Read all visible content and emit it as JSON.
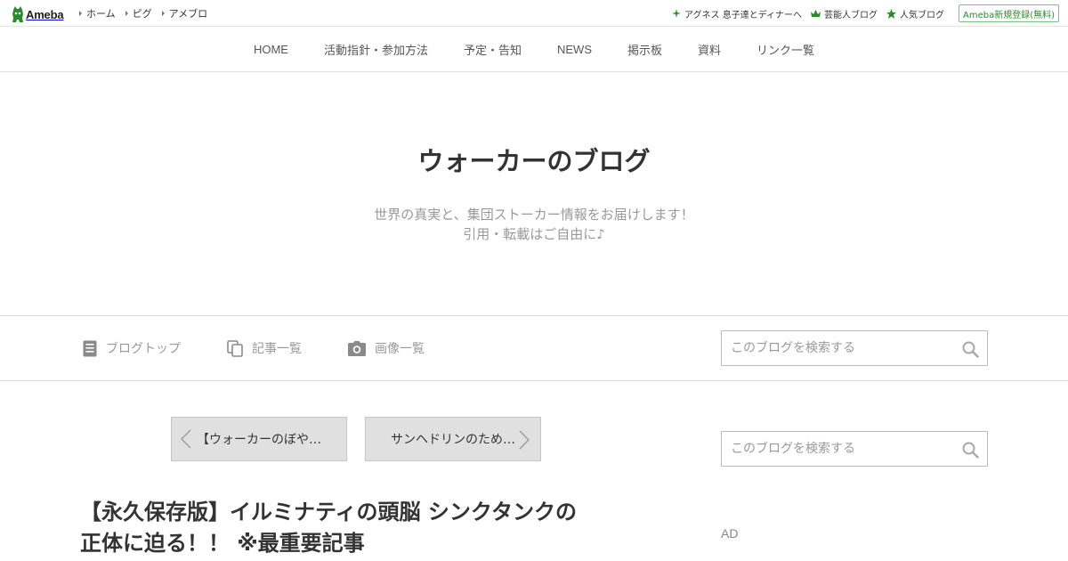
{
  "topbar": {
    "logo_text": "Ameba",
    "left_links": [
      "ホーム",
      "ピグ",
      "アメブロ"
    ],
    "right_links": [
      {
        "icon": "sparkle-icon",
        "label": "アグネス 息子達とディナーへ"
      },
      {
        "icon": "crown-icon",
        "label": "芸能人ブログ"
      },
      {
        "icon": "star-icon",
        "label": "人気ブログ"
      }
    ],
    "register_label": "Ameba新規登録(無料)"
  },
  "blog_nav": [
    "HOME",
    "活動指針・参加方法",
    "予定・告知",
    "NEWS",
    "掲示板",
    "資料",
    "リンク一覧"
  ],
  "header": {
    "title": "ウォーカーのブログ",
    "description_line1": "世界の真実と、集団ストーカー情報をお届けします！",
    "description_line2": "引用・転載はご自由に♪"
  },
  "sub_nav": [
    {
      "icon": "document-icon",
      "label": "ブログトップ"
    },
    {
      "icon": "copy-icon",
      "label": "記事一覧"
    },
    {
      "icon": "camera-icon",
      "label": "画像一覧"
    }
  ],
  "search": {
    "placeholder": "このブログを検索する"
  },
  "sidebar_search": {
    "placeholder": "このブログを検索する"
  },
  "pager": {
    "prev_label": "【ウォーカーのぼや…",
    "next_label": "サンヘドリンのため…"
  },
  "article": {
    "title_line1": "【永久保存版】イルミナティの頭脳 シンクタンクの",
    "title_line2": "正体に迫る！！ ※最重要記事"
  },
  "sidebar": {
    "ad_label": "AD"
  },
  "colors": {
    "ameba_green": "#2d8a2d",
    "border": "#dadada",
    "muted_text": "#999999"
  }
}
